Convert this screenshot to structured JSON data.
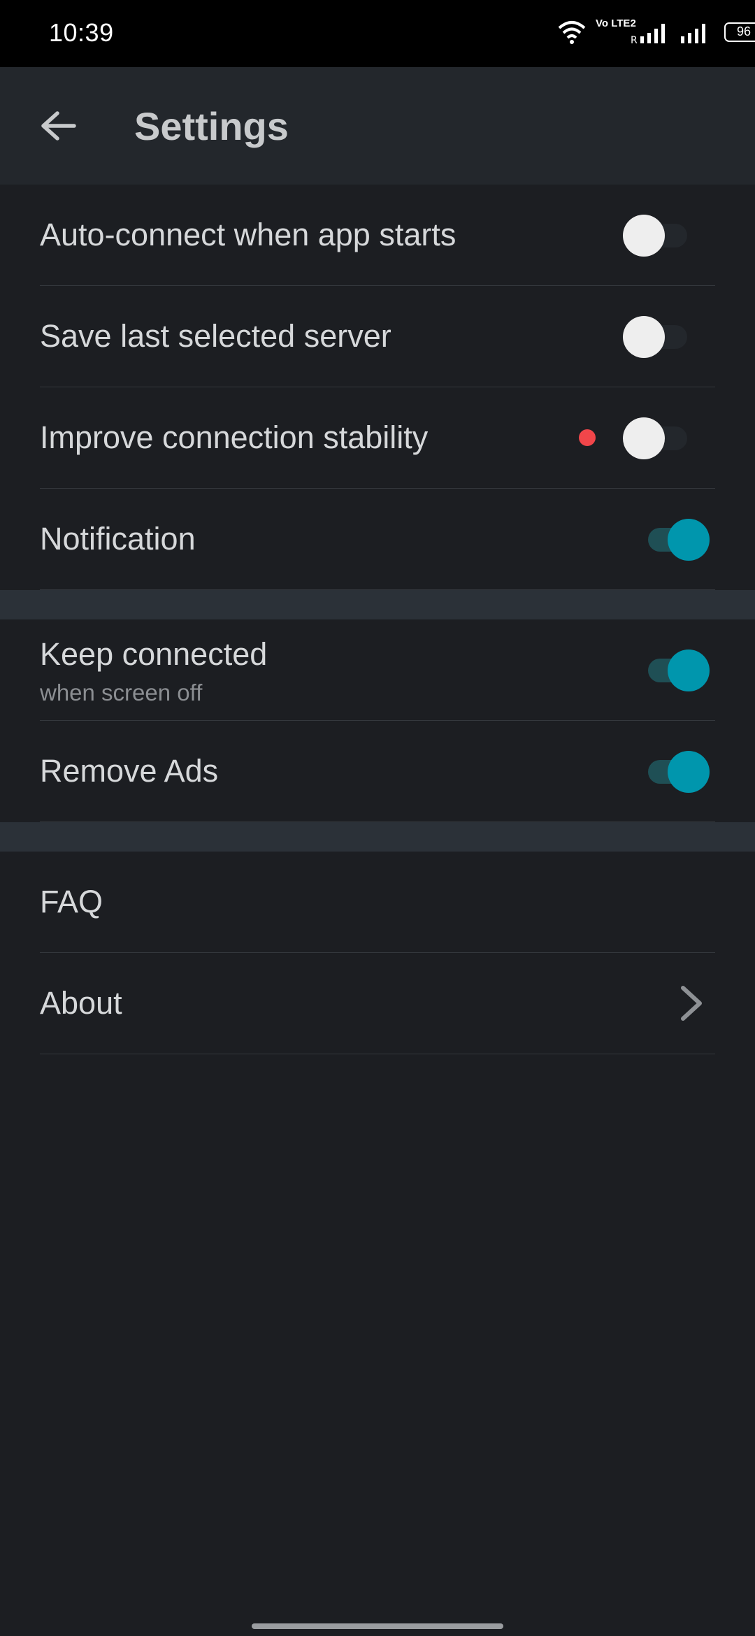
{
  "status_bar": {
    "time": "10:39",
    "network_label": "Vo LTE2",
    "roaming_label": "R",
    "battery": "96"
  },
  "app_bar": {
    "title": "Settings"
  },
  "sections": {
    "connection": [
      {
        "label": "Auto-connect when app starts",
        "enabled": false
      },
      {
        "label": "Save last selected server",
        "enabled": false
      },
      {
        "label": "Improve connection stability",
        "enabled": false,
        "badge": "red-dot"
      },
      {
        "label": "Notification",
        "enabled": true
      }
    ],
    "background": [
      {
        "label": "Keep connected",
        "sublabel": "when screen off",
        "enabled": true
      },
      {
        "label": "Remove Ads",
        "enabled": true
      }
    ],
    "info": [
      {
        "label": "FAQ"
      },
      {
        "label": "About",
        "icon": "chevron-right-icon"
      }
    ]
  },
  "colors": {
    "background": "#1c1e22",
    "app_bar": "#23272c",
    "accent": "#0096ad",
    "badge": "#f1464a",
    "divider_band": "#2b3138"
  }
}
